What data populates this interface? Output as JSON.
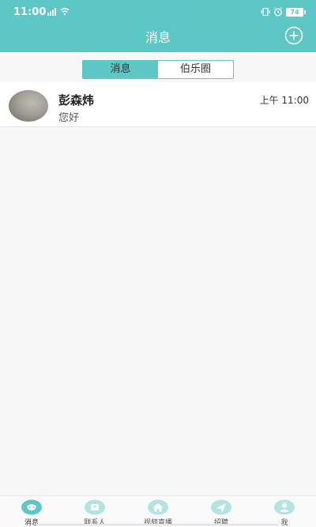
{
  "status_bar": {
    "time": "11:00",
    "battery": "74"
  },
  "header": {
    "title": "消息"
  },
  "segment": {
    "tabs": [
      {
        "label": "消息"
      },
      {
        "label": "伯乐圈"
      }
    ]
  },
  "chats": [
    {
      "name": "彭森炜",
      "preview": "您好",
      "time": "上午 11:00"
    }
  ],
  "tabbar": {
    "items": [
      {
        "label": "消息",
        "icon": "chat-bubble-icon"
      },
      {
        "label": "联系人",
        "icon": "contacts-icon"
      },
      {
        "label": "视频直播",
        "icon": "home-icon"
      },
      {
        "label": "招聘",
        "icon": "paper-plane-icon"
      },
      {
        "label": "我",
        "icon": "user-icon"
      }
    ]
  },
  "colors": {
    "accent": "#5cc7c4",
    "accent_light": "#b5e3e1"
  }
}
